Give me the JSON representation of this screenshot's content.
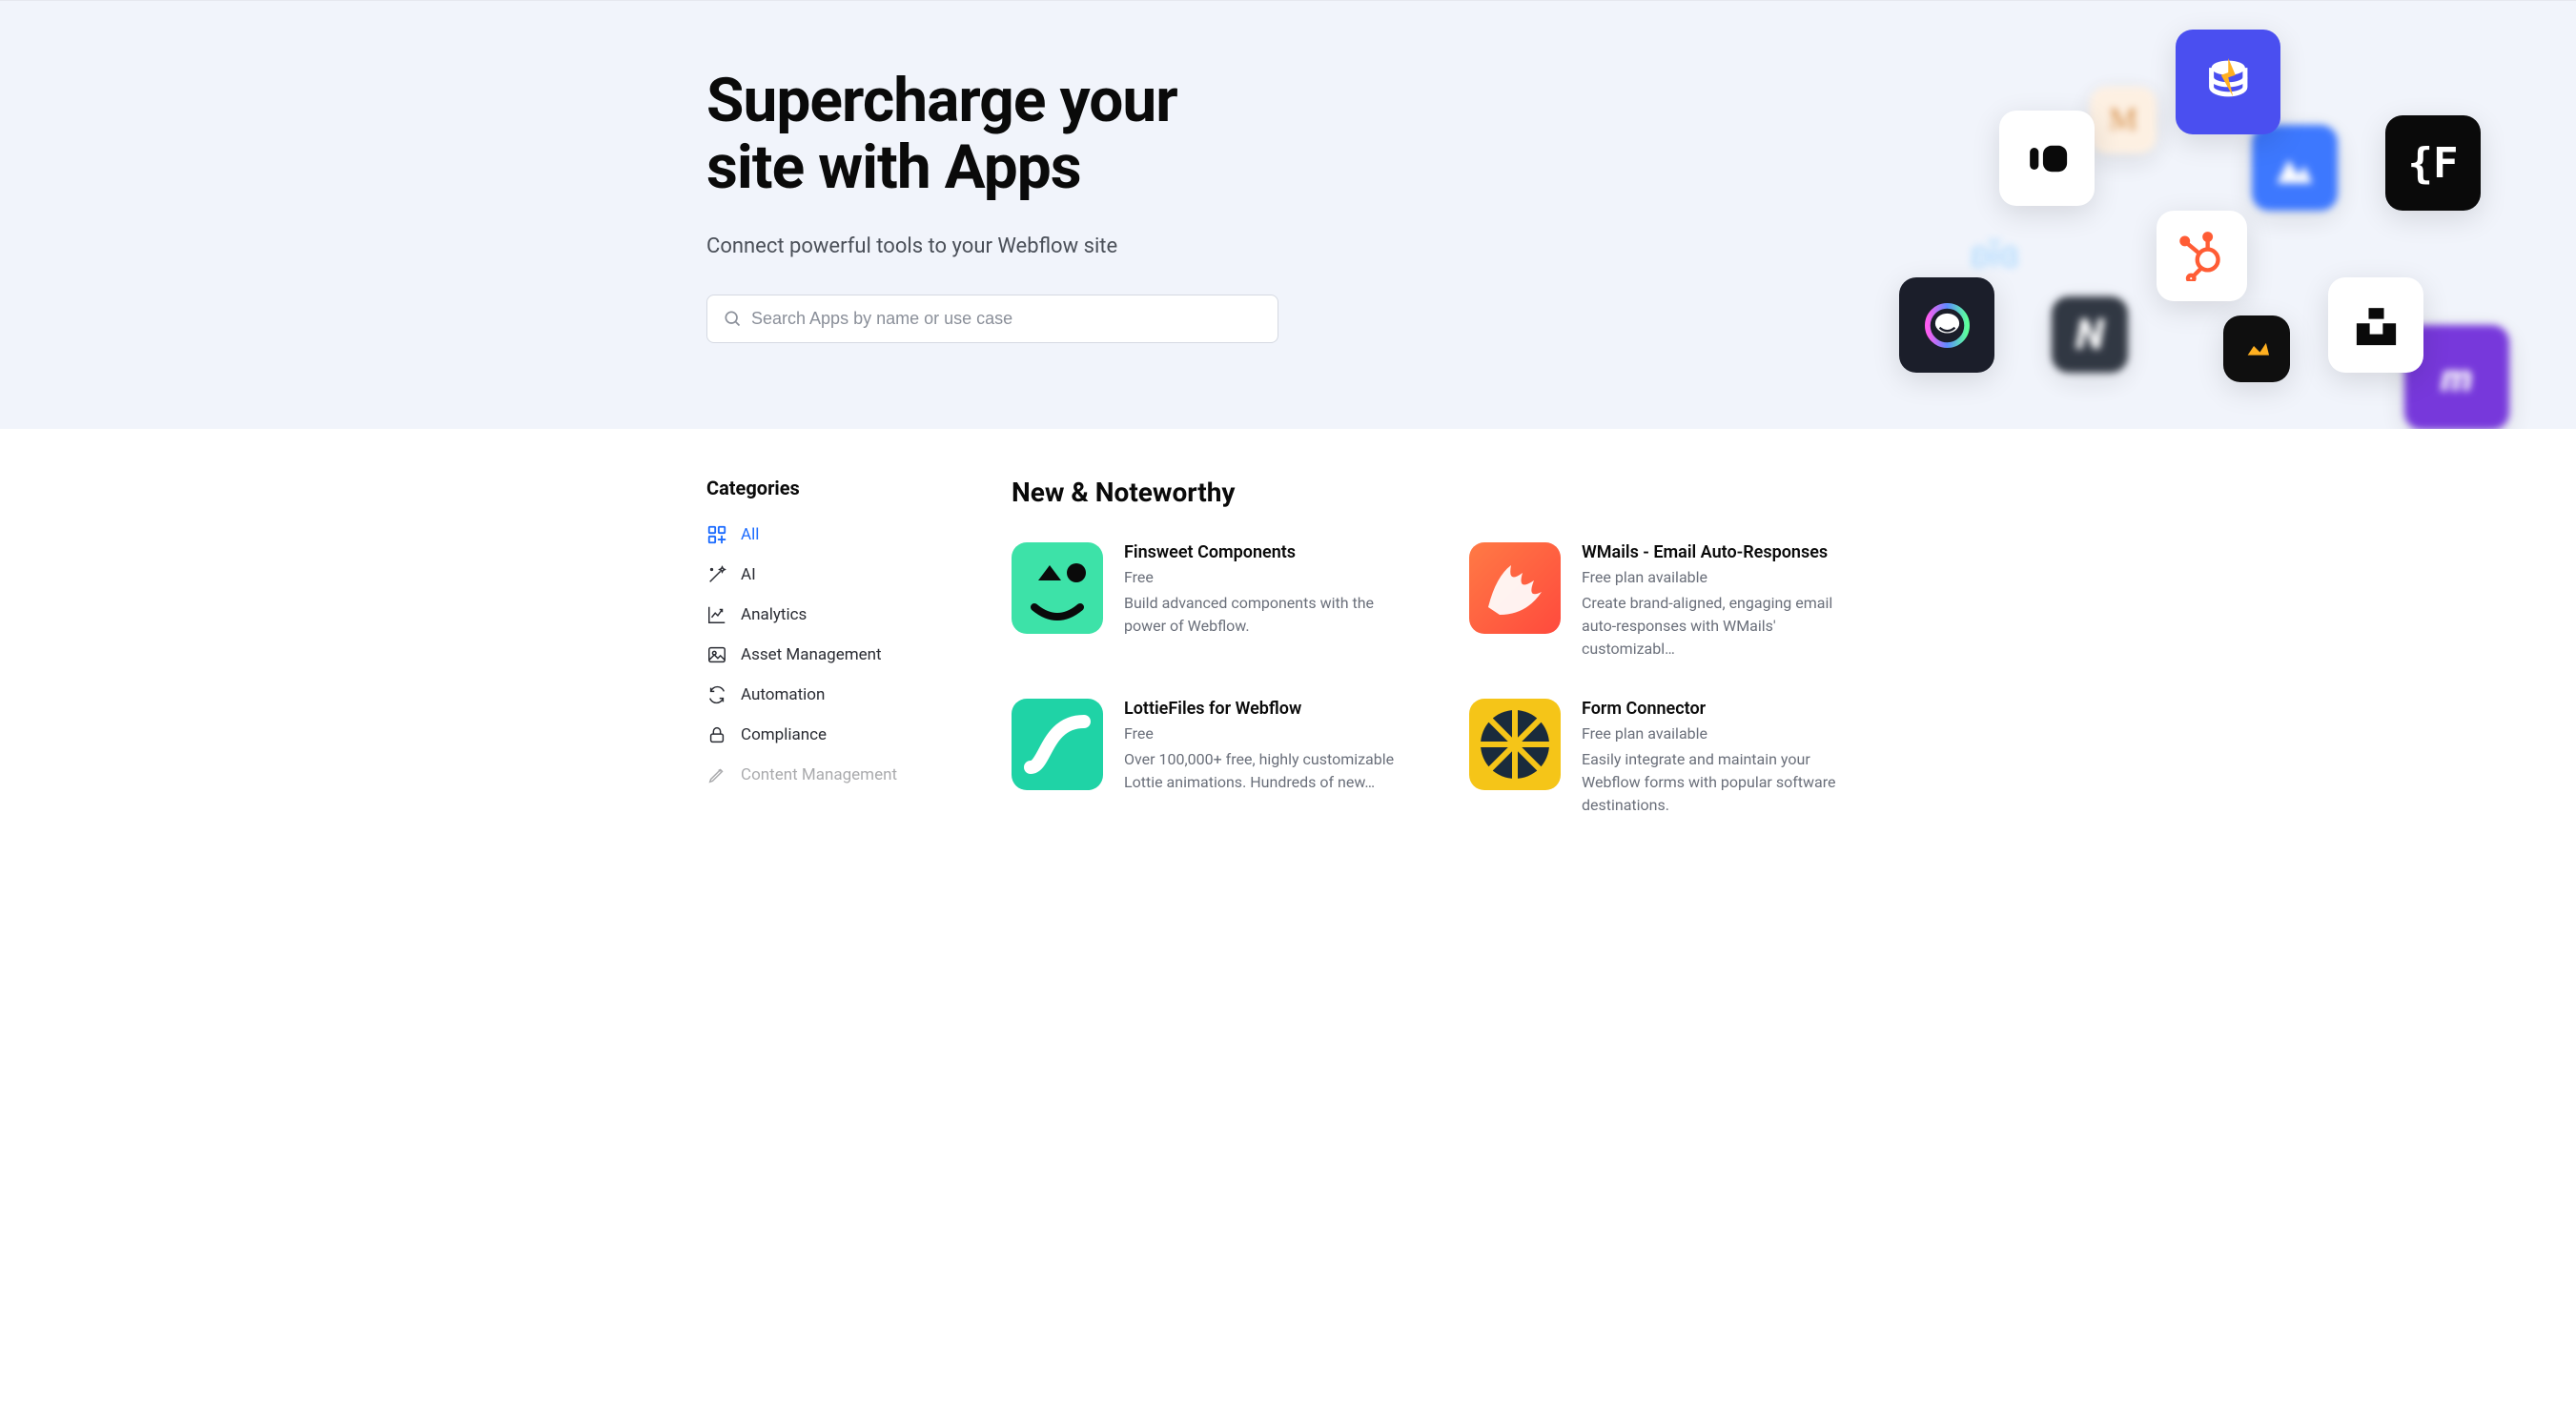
{
  "hero": {
    "title_line1": "Supercharge your",
    "title_line2": "site with Apps",
    "subtitle": "Connect powerful tools to your Webflow site",
    "search_placeholder": "Search Apps by name or use case"
  },
  "sidebar": {
    "title": "Categories",
    "items": [
      {
        "label": "All",
        "active": true
      },
      {
        "label": "AI",
        "active": false
      },
      {
        "label": "Analytics",
        "active": false
      },
      {
        "label": "Asset Management",
        "active": false
      },
      {
        "label": "Automation",
        "active": false
      },
      {
        "label": "Compliance",
        "active": false
      },
      {
        "label": "Content Management",
        "active": false
      }
    ]
  },
  "section": {
    "title": "New & Noteworthy",
    "apps": [
      {
        "name": "Finsweet Components",
        "price": "Free",
        "desc": "Build advanced components with the power of Webflow."
      },
      {
        "name": "WMails - Email Auto-Responses",
        "price": "Free plan available",
        "desc": "Create brand-aligned, engaging email auto-responses with WMails' customizabl…"
      },
      {
        "name": "LottieFiles for Webflow",
        "price": "Free",
        "desc": "Over 100,000+ free, highly customizable Lottie animations. Hundreds of new…"
      },
      {
        "name": "Form Connector",
        "price": "Free plan available",
        "desc": "Easily integrate and maintain your Webflow forms with popular software destinations."
      }
    ]
  }
}
